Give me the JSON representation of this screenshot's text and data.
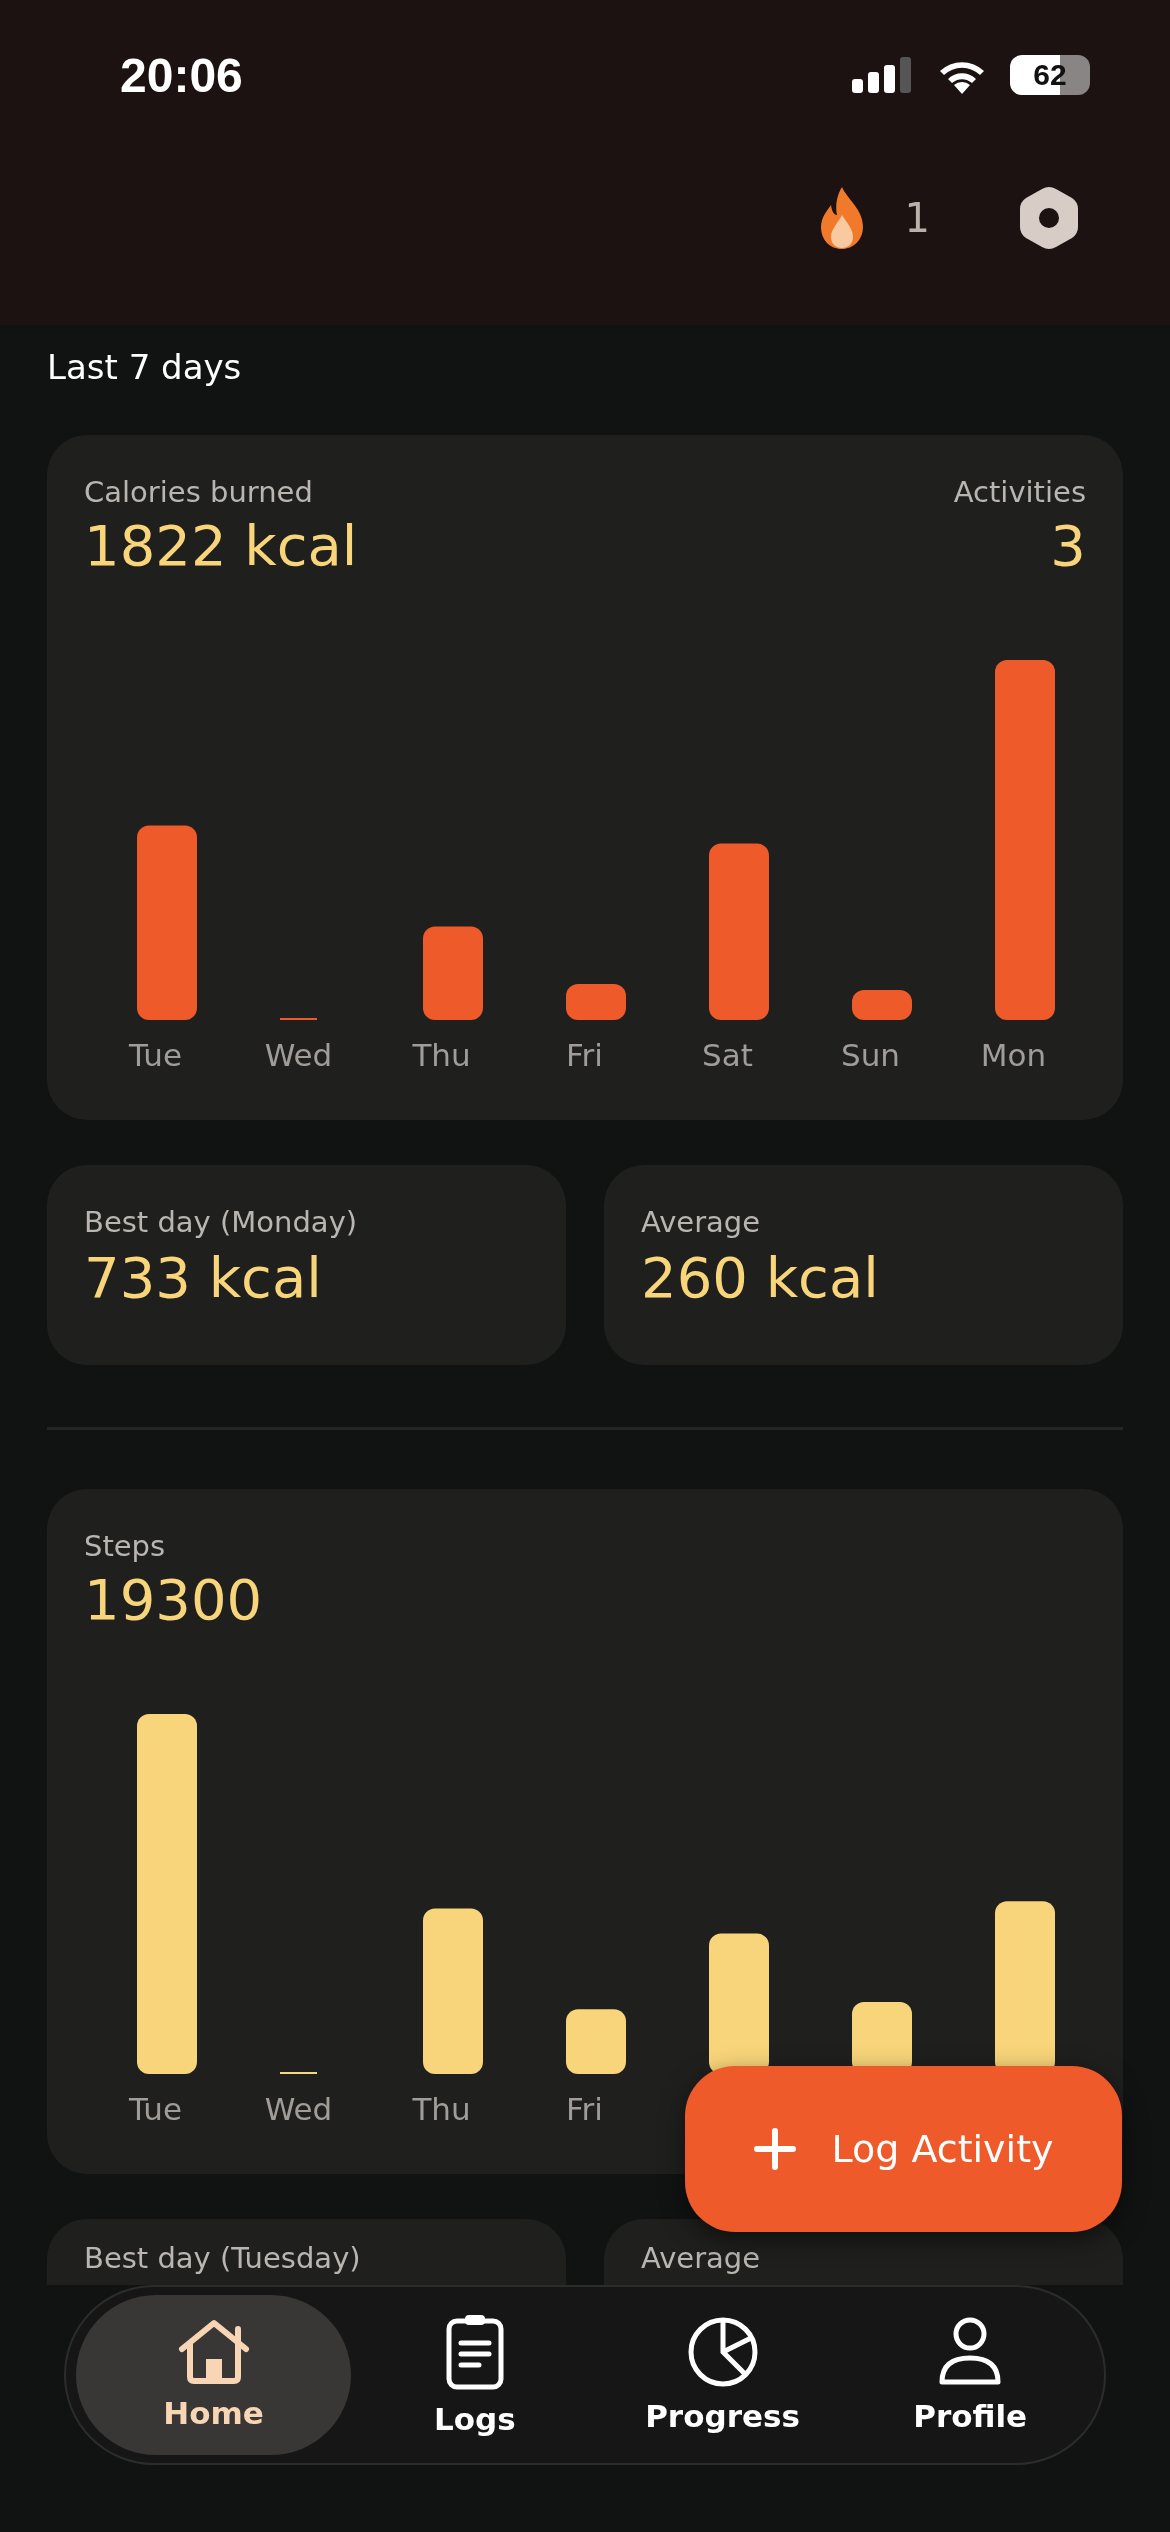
{
  "status_bar": {
    "time": "20:06",
    "battery": "62"
  },
  "header": {
    "streak": "1"
  },
  "period": "Last 7 days",
  "calories_card": {
    "label": "Calories burned",
    "value": "1822 kcal",
    "side_label": "Activities",
    "side_value": "3",
    "days": [
      "Tue",
      "Wed",
      "Thu",
      "Fri",
      "Sat",
      "Sun",
      "Mon"
    ]
  },
  "calorie_stats": [
    {
      "label": "Best day (Monday)",
      "value": "733 kcal"
    },
    {
      "label": "Average",
      "value": "260 kcal"
    }
  ],
  "steps_card": {
    "label": "Steps",
    "value": "19300",
    "days": [
      "Tue",
      "Wed",
      "Thu",
      "Fri"
    ]
  },
  "step_stats": [
    {
      "label": "Best day (Tuesday)"
    },
    {
      "label": "Average"
    }
  ],
  "fab": {
    "label": "Log Activity"
  },
  "nav": [
    {
      "kind": "home",
      "label": "Home",
      "selected": true
    },
    {
      "kind": "logs",
      "label": "Logs",
      "selected": false
    },
    {
      "kind": "progress",
      "label": "Progress",
      "selected": false
    },
    {
      "kind": "profile",
      "label": "Profile",
      "selected": false
    }
  ]
}
